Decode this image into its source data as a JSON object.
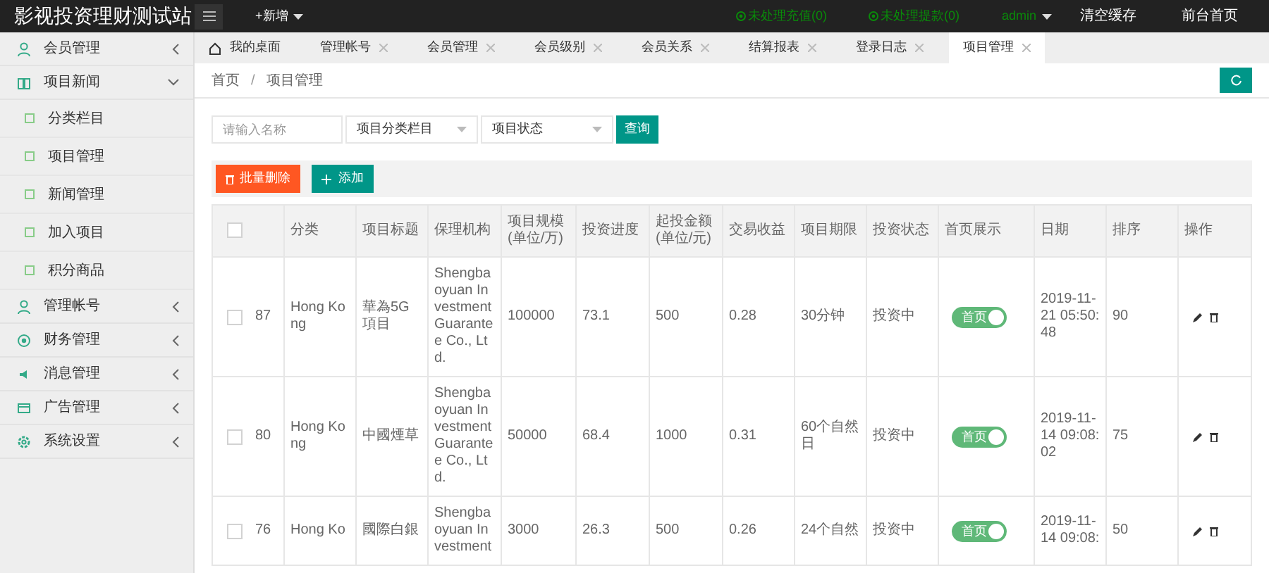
{
  "header": {
    "title": "影视投资理财测试站",
    "add_menu": "+新增",
    "links": [
      {
        "kind": "alert",
        "label": "未处理充值(0)"
      },
      {
        "kind": "alert",
        "label": "未处理提款(0)"
      },
      {
        "kind": "user",
        "label": "admin"
      },
      {
        "kind": "plain",
        "label": "清空缓存"
      },
      {
        "kind": "plain",
        "label": "前台首页"
      }
    ]
  },
  "sidebar": {
    "items": [
      {
        "label": "会员管理",
        "expanded": false
      },
      {
        "label": "项目新闻",
        "expanded": true,
        "children": [
          {
            "label": "分类栏目"
          },
          {
            "label": "项目管理"
          },
          {
            "label": "新闻管理"
          },
          {
            "label": "加入项目"
          },
          {
            "label": "积分商品"
          }
        ]
      },
      {
        "label": "管理帐号",
        "expanded": false
      },
      {
        "label": "财务管理",
        "expanded": false
      },
      {
        "label": "消息管理",
        "expanded": false
      },
      {
        "label": "广告管理",
        "expanded": false
      },
      {
        "label": "系统设置",
        "expanded": false
      }
    ]
  },
  "tabs": [
    {
      "label": "我的桌面",
      "kind": "home",
      "selected": false
    },
    {
      "label": "管理帐号",
      "kind": "closable",
      "selected": false
    },
    {
      "label": "会员管理",
      "kind": "closable",
      "selected": false
    },
    {
      "label": "会员级别",
      "kind": "closable",
      "selected": false
    },
    {
      "label": "会员关系",
      "kind": "closable",
      "selected": false
    },
    {
      "label": "结算报表",
      "kind": "closable",
      "selected": false
    },
    {
      "label": "登录日志",
      "kind": "closable",
      "selected": false
    },
    {
      "label": "项目管理",
      "kind": "closable",
      "selected": true
    }
  ],
  "breadcrumb": [
    "首页",
    "/",
    "项目管理"
  ],
  "filters": {
    "name_placeholder": "请输入名称",
    "category": "项目分类栏目",
    "status": "项目状态",
    "search_button": "查询"
  },
  "actions": {
    "batch_delete": "批量删除",
    "add": "添加"
  },
  "table": {
    "select_all_checked": false,
    "columns": [
      "分类",
      "项目标题",
      "保理机构",
      "项目规模\n(单位/万)",
      "投资进度",
      "起投金额\n(单位/元)",
      "交易收益",
      "项目期限",
      "投资状态",
      "首页展示",
      "日期",
      "排序",
      "操作"
    ],
    "rows": [
      {
        "checked": false,
        "id": "87",
        "category": "Hong Kong",
        "title": "華為5G項目",
        "institution": "Shengbaoyuan Investment Guarantee Co., Ltd.",
        "scale": "100000",
        "progress": "73.1",
        "min_amount": "500",
        "return": "0.28",
        "term": "30分钟",
        "status": "投资中",
        "home_label": "首页",
        "home_on": true,
        "date": "2019-11-21 05:50:48",
        "sort": "90"
      },
      {
        "checked": false,
        "id": "80",
        "category": "Hong Kong",
        "title": "中國煙草",
        "institution": "Shengbaoyuan Investment Guarantee Co., Ltd.",
        "scale": "50000",
        "progress": "68.4",
        "min_amount": "1000",
        "return": "0.31",
        "term": "60个自然日",
        "status": "投资中",
        "home_label": "首页",
        "home_on": true,
        "date": "2019-11-14 09:08:02",
        "sort": "75"
      },
      {
        "checked": false,
        "id": "76",
        "category": "Hong Ko",
        "title": "國際白銀",
        "institution": "Shengbaoyuan Investment",
        "scale": "3000",
        "progress": "26.3",
        "min_amount": "500",
        "return": "0.26",
        "term": "24个自然",
        "status": "投资中",
        "home_label": "首页",
        "home_on": true,
        "date": "2019-11-14 09:08:",
        "sort": "50"
      }
    ]
  }
}
